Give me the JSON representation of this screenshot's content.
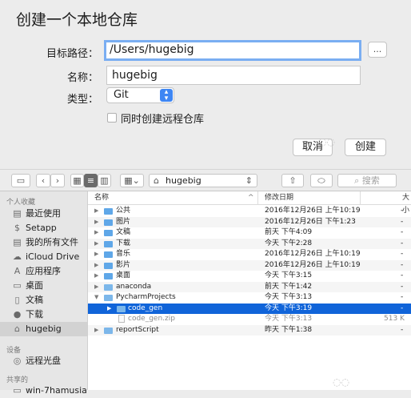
{
  "dialog": {
    "title": "创建一个本地仓库",
    "path_label": "目标路径：",
    "path_value": "/Users/hugebig",
    "browse_label": "...",
    "name_label": "名称：",
    "name_value": "hugebig",
    "type_label": "类型：",
    "type_value": "Git",
    "also_remote_label": "同时创建远程仓库",
    "cancel_label": "取消",
    "create_label": "创建"
  },
  "toolbar": {
    "location": "hugebig",
    "search_placeholder": "搜索"
  },
  "sidebar": {
    "sections": [
      {
        "header": "个人收藏",
        "items": [
          {
            "label": "最近使用",
            "icon": "clock-icon"
          },
          {
            "label": "Setapp",
            "icon": "setapp-icon"
          },
          {
            "label": "我的所有文件",
            "icon": "all-files-icon"
          },
          {
            "label": "iCloud Drive",
            "icon": "cloud-icon"
          },
          {
            "label": "应用程序",
            "icon": "apps-icon"
          },
          {
            "label": "桌面",
            "icon": "desktop-icon"
          },
          {
            "label": "文稿",
            "icon": "documents-icon"
          },
          {
            "label": "下载",
            "icon": "download-icon"
          },
          {
            "label": "hugebig",
            "icon": "home-icon",
            "selected": true
          }
        ]
      },
      {
        "header": "设备",
        "items": [
          {
            "label": "远程光盘",
            "icon": "disc-icon"
          }
        ]
      },
      {
        "header": "共享的",
        "items": [
          {
            "label": "win-7hamusia",
            "icon": "display-icon"
          }
        ]
      }
    ]
  },
  "list": {
    "col_name": "名称",
    "col_date": "修改日期",
    "col_size": "大小",
    "sort_indicator": "^",
    "rows": [
      {
        "name": "公共",
        "date": "2016年12月26日 上午10:19",
        "size": "-"
      },
      {
        "name": "图片",
        "date": "2016年12月26日 下午1:23",
        "size": "-"
      },
      {
        "name": "文稿",
        "date": "前天 下午4:09",
        "size": "-"
      },
      {
        "name": "下载",
        "date": "今天 下午2:28",
        "size": "-"
      },
      {
        "name": "音乐",
        "date": "2016年12月26日 上午10:19",
        "size": "-"
      },
      {
        "name": "影片",
        "date": "2016年12月26日 上午10:19",
        "size": "-"
      },
      {
        "name": "桌面",
        "date": "今天 下午3:15",
        "size": "-"
      },
      {
        "name": "anaconda",
        "date": "前天 下午1:42",
        "size": "-"
      },
      {
        "name": "PycharmProjects",
        "date": "今天 下午3:13",
        "size": "-",
        "expanded": true
      },
      {
        "name": "code_gen",
        "date": "今天 下午3:19",
        "size": "-",
        "selected": true,
        "child": true
      },
      {
        "name": "code_gen.zip",
        "date": "今天 下午3:13",
        "size": "513 K",
        "child": true,
        "file": true,
        "dim": true
      },
      {
        "name": "reportScript",
        "date": "昨天 下午1:38",
        "size": "-"
      }
    ]
  },
  "colors": {
    "selection": "#1064d9",
    "focus_ring": "#7aaef2",
    "accent": "#3e86f3"
  }
}
